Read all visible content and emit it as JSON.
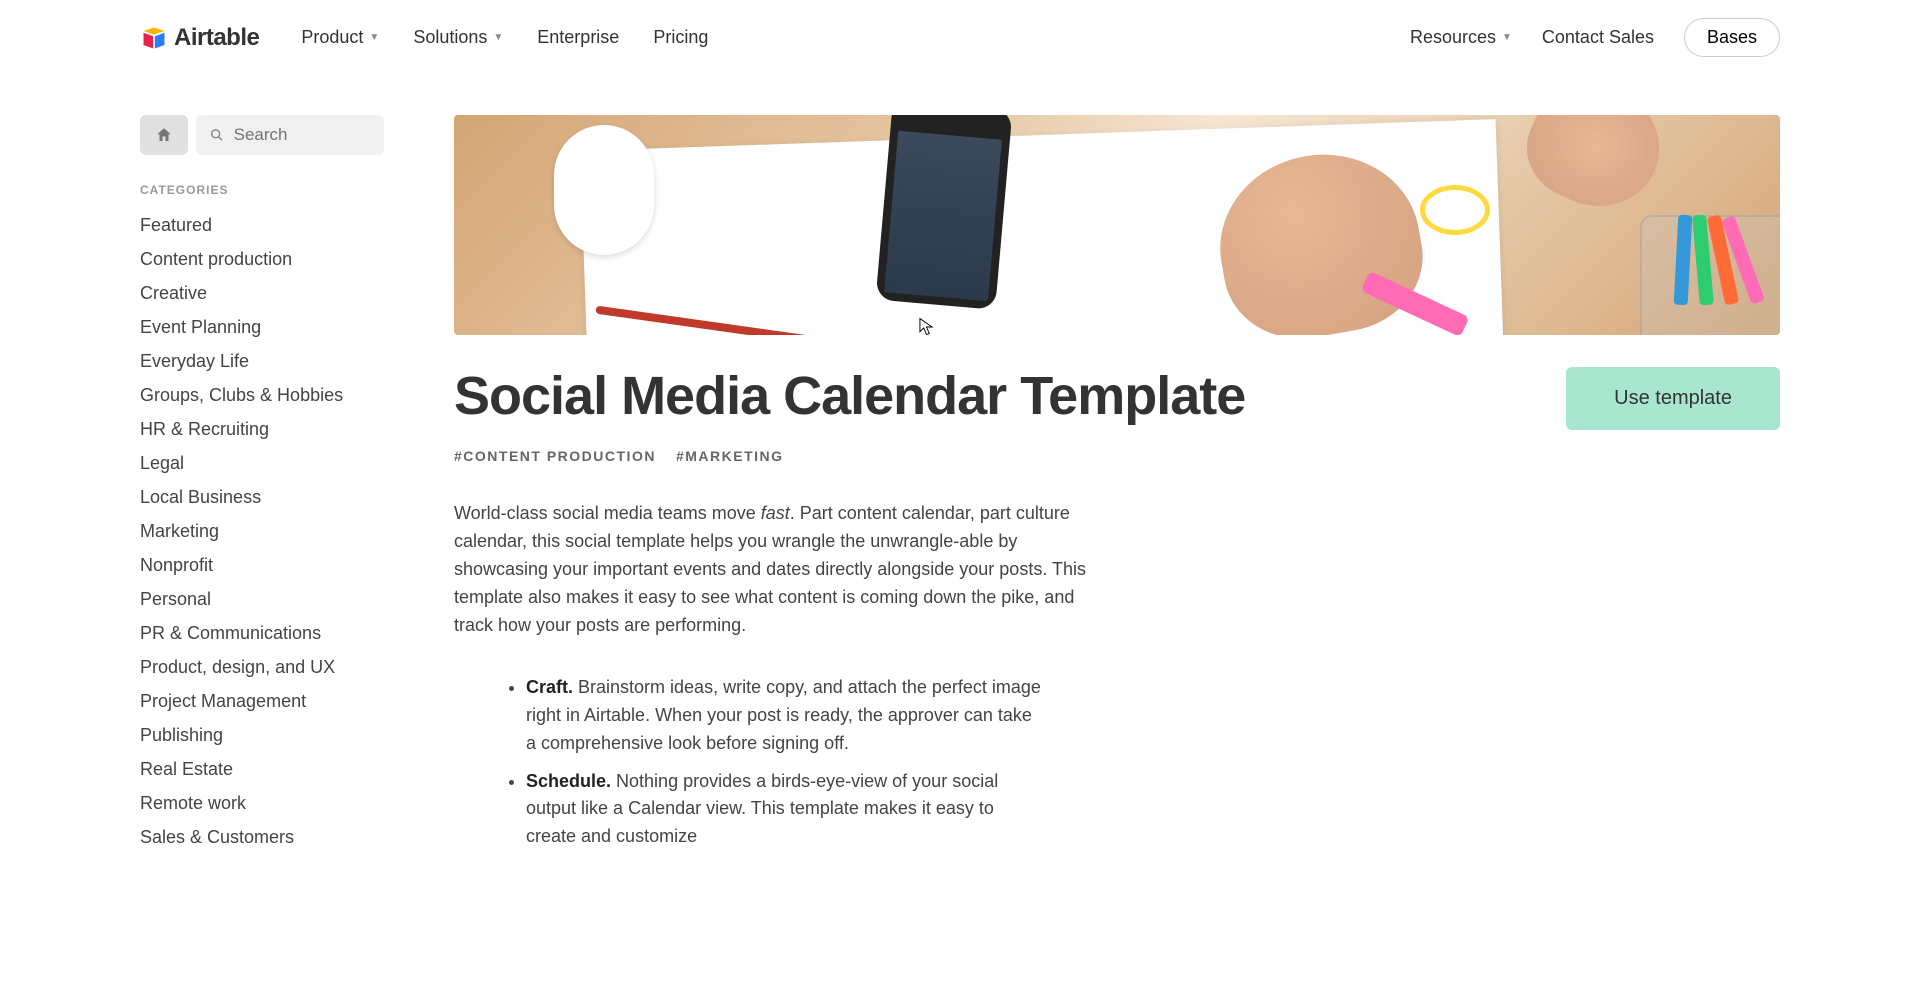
{
  "header": {
    "logo_text": "Airtable",
    "nav_left": [
      {
        "label": "Product",
        "has_dropdown": true
      },
      {
        "label": "Solutions",
        "has_dropdown": true
      },
      {
        "label": "Enterprise",
        "has_dropdown": false
      },
      {
        "label": "Pricing",
        "has_dropdown": false
      }
    ],
    "nav_right": [
      {
        "label": "Resources",
        "has_dropdown": true
      },
      {
        "label": "Contact Sales",
        "has_dropdown": false
      }
    ],
    "bases_label": "Bases"
  },
  "sidebar": {
    "search_placeholder": "Search",
    "categories_heading": "CATEGORIES",
    "categories": [
      "Featured",
      "Content production",
      "Creative",
      "Event Planning",
      "Everyday Life",
      "Groups, Clubs & Hobbies",
      "HR & Recruiting",
      "Legal",
      "Local Business",
      "Marketing",
      "Nonprofit",
      "Personal",
      "PR & Communications",
      "Product, design, and UX",
      "Project Management",
      "Publishing",
      "Real Estate",
      "Remote work",
      "Sales & Customers"
    ]
  },
  "main": {
    "title": "Social Media Calendar Template",
    "tags": [
      "#CONTENT PRODUCTION",
      "#MARKETING"
    ],
    "use_template_label": "Use template",
    "intro_lead": "World-class social media teams move ",
    "intro_fast": "fast",
    "intro_rest": ". Part content calendar, part culture calendar, this social template helps you wrangle the unwrangle-able by showcasing your important events and dates directly alongside your posts. This template also makes it easy to see what content is coming down the pike, and track how your posts are performing.",
    "bullets": [
      {
        "bold": "Craft.",
        "text": " Brainstorm ideas, write copy, and attach the perfect image right in Airtable. When your post is ready, the approver can take a comprehensive look before signing off."
      },
      {
        "bold": "Schedule.",
        "text": " Nothing provides a birds-eye-view of your social output like a Calendar view. This template makes it easy to create and customize"
      }
    ]
  }
}
